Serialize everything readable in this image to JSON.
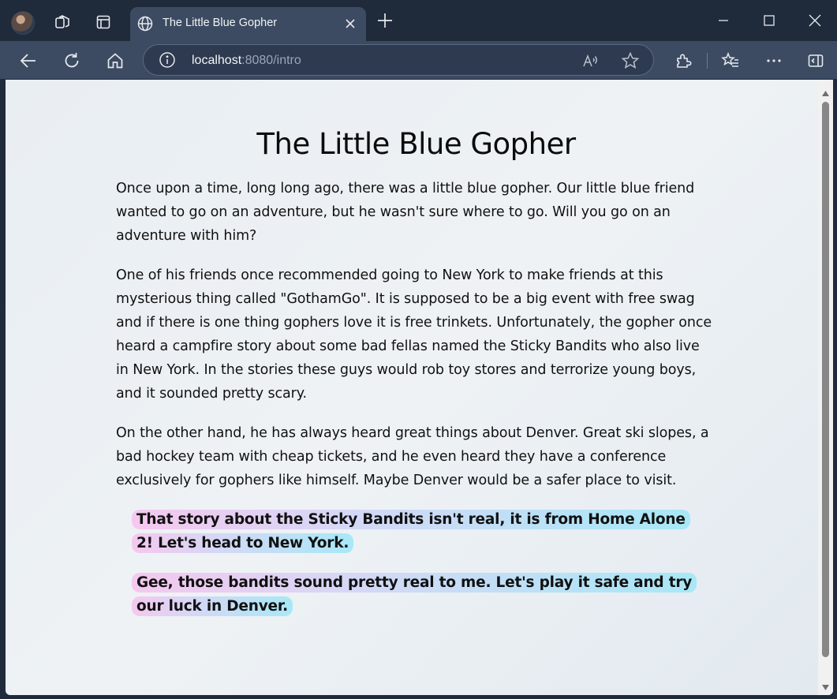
{
  "browser": {
    "tab_title": "The Little Blue Gopher",
    "url_host": "localhost",
    "url_rest": ":8080/intro"
  },
  "icons": {
    "titlebar": [
      "profile-avatar",
      "collections-icon",
      "tab-actions-icon",
      "globe-icon",
      "close-icon",
      "plus-icon",
      "minimize-icon",
      "maximize-icon",
      "window-close-icon"
    ],
    "toolbar": [
      "back-arrow-icon",
      "refresh-icon",
      "home-icon",
      "info-icon",
      "read-aloud-icon",
      "star-icon",
      "extensions-icon",
      "favorites-icon",
      "more-icon",
      "sidebar-icon"
    ]
  },
  "page": {
    "title": "The Little Blue Gopher",
    "paragraphs": [
      "Once upon a time, long long ago, there was a little blue gopher. Our little blue friend wanted to go on an adventure, but he wasn't sure where to go. Will you go on an adventure with him?",
      "One of his friends once recommended going to New York to make friends at this mysterious thing called \"GothamGo\". It is supposed to be a big event with free swag and if there is one thing gophers love it is free trinkets. Unfortunately, the gopher once heard a campfire story about some bad fellas named the Sticky Bandits who also live in New York. In the stories these guys would rob toy stores and terrorize young boys, and it sounded pretty scary.",
      "On the other hand, he has always heard great things about Denver. Great ski slopes, a bad hockey team with cheap tickets, and he even heard they have a conference exclusively for gophers like himself. Maybe Denver would be a safer place to visit."
    ],
    "choices": [
      "That story about the Sticky Bandits isn't real, it is from Home Alone 2! Let's head to New York.",
      "Gee, those bandits sound pretty real to me. Let's play it safe and try our luck in Denver."
    ]
  },
  "colors": {
    "titlebar_bg": "#1f2a3a",
    "toolbar_bg": "#3c4b62",
    "choice_gradient_start": "#f6c8ef",
    "choice_gradient_end": "#a7e8f7"
  }
}
